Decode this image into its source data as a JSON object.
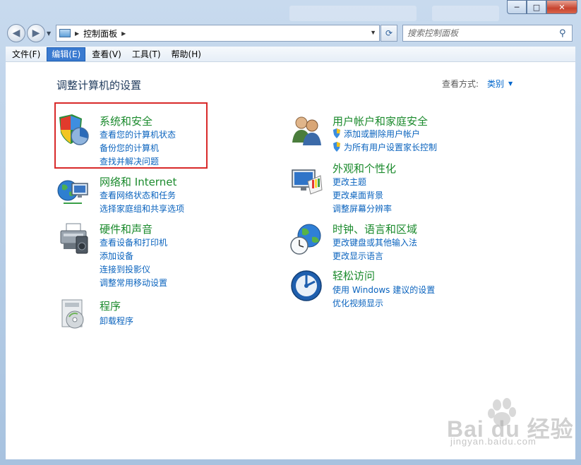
{
  "window": {
    "controls": {
      "minimize": "─",
      "maximize": "□",
      "close": "✕"
    }
  },
  "navigation": {
    "address_crumb": "控制面板",
    "search_placeholder": "搜索控制面板"
  },
  "menu": [
    {
      "label": "文件(F)"
    },
    {
      "label": "编辑(E)",
      "active": true
    },
    {
      "label": "查看(V)"
    },
    {
      "label": "工具(T)"
    },
    {
      "label": "帮助(H)"
    }
  ],
  "page": {
    "title": "调整计算机的设置",
    "view_by_label": "查看方式:",
    "view_by_value": "类别"
  },
  "categories": {
    "system_security": {
      "title": "系统和安全",
      "links": [
        "查看您的计算机状态",
        "备份您的计算机",
        "查找并解决问题"
      ],
      "icon": "shield-pie-icon"
    },
    "network": {
      "title": "网络和 Internet",
      "links": [
        "查看网络状态和任务",
        "选择家庭组和共享选项"
      ],
      "icon": "globe-network-icon"
    },
    "hardware": {
      "title": "硬件和声音",
      "links": [
        "查看设备和打印机",
        "添加设备",
        "连接到投影仪",
        "调整常用移动设置"
      ],
      "icon": "printer-icon"
    },
    "programs": {
      "title": "程序",
      "links": [
        "卸载程序"
      ],
      "icon": "programs-disc-icon"
    },
    "user_accounts": {
      "title": "用户帐户和家庭安全",
      "links": [
        "添加或删除用户帐户",
        "为所有用户设置家长控制"
      ],
      "icon": "users-icon"
    },
    "appearance": {
      "title": "外观和个性化",
      "links": [
        "更改主题",
        "更改桌面背景",
        "调整屏幕分辨率"
      ],
      "icon": "monitor-palette-icon"
    },
    "clock": {
      "title": "时钟、语言和区域",
      "links": [
        "更改键盘或其他输入法",
        "更改显示语言"
      ],
      "icon": "globe-clock-icon"
    },
    "ease": {
      "title": "轻松访问",
      "links": [
        "使用 Windows 建议的设置",
        "优化视频显示"
      ],
      "icon": "ease-of-access-icon"
    }
  },
  "watermark": {
    "brand": "Bai du 经验",
    "url": "jingyan.baidu.com"
  },
  "colors": {
    "category_title": "#1a8a2c",
    "link": "#0a63be",
    "highlight_box": "#d82a2a",
    "menu_active": "#3a7ad0"
  }
}
